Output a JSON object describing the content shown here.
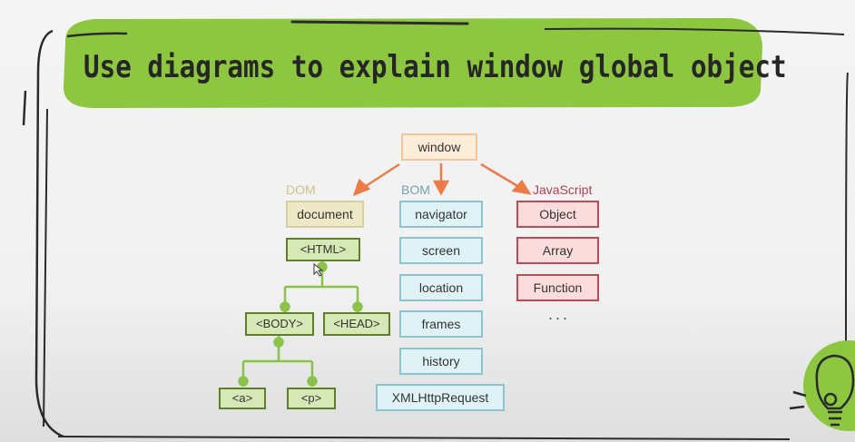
{
  "slide": {
    "title": "Use diagrams to explain window global object"
  },
  "diagram": {
    "root": {
      "label": "window"
    },
    "groups": {
      "dom": {
        "label": "DOM",
        "color": "#cbc481",
        "document": "document",
        "tree": {
          "html": "<HTML>",
          "body": "<BODY>",
          "head": "<HEAD>",
          "a": "<a>",
          "p": "<p>"
        }
      },
      "bom": {
        "label": "BOM",
        "color": "#6fa6b0",
        "items": [
          "navigator",
          "screen",
          "location",
          "frames",
          "history",
          "XMLHttpRequest"
        ]
      },
      "javascript": {
        "label": "JavaScript",
        "color": "#b33f52",
        "items": [
          "Object",
          "Array",
          "Function"
        ],
        "more": "..."
      }
    },
    "colors": {
      "arrow": "#ee7b47",
      "tree_connector": "#8bc34a",
      "banner": "#8dc63f"
    }
  }
}
